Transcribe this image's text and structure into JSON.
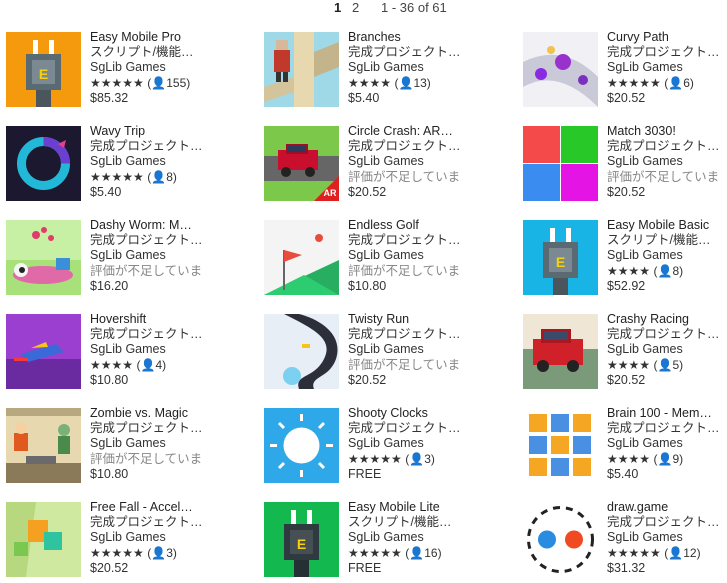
{
  "pagination": {
    "page1": "1",
    "page2": "2",
    "range": "1 - 36 of 61"
  },
  "items": [
    {
      "title": "Easy Mobile Pro",
      "category": "スクリプト/機能…",
      "publisher": "SgLib Games",
      "stars": "★★★★★",
      "count": "(👤155)",
      "price": "$85.32",
      "icon": "plug-orange-icon"
    },
    {
      "title": "Branches",
      "category": "完成プロジェクト…",
      "publisher": "SgLib Games",
      "stars": "★★★★",
      "count": "(👤13)",
      "price": "$5.40",
      "icon": "branches-icon"
    },
    {
      "title": "Curvy Path",
      "category": "完成プロジェクト…",
      "publisher": "SgLib Games",
      "stars": "★★★★★",
      "count": "(👤6)",
      "price": "$20.52",
      "icon": "curvy-path-icon"
    },
    {
      "title": "Wavy Trip",
      "category": "完成プロジェクト…",
      "publisher": "SgLib Games",
      "stars": "★★★★★",
      "count": "(👤8)",
      "price": "$5.40",
      "icon": "wavy-trip-icon"
    },
    {
      "title": "Circle Crash: AR…",
      "category": "完成プロジェクト…",
      "publisher": "SgLib Games",
      "no_rating": "評価が不足していま",
      "price": "$20.52",
      "icon": "circle-crash-icon"
    },
    {
      "title": "Match 3030!",
      "category": "完成プロジェクト…",
      "publisher": "SgLib Games",
      "no_rating": "評価が不足していま",
      "price": "$20.52",
      "icon": "match-3030-icon"
    },
    {
      "title": "Dashy Worm: M…",
      "category": "完成プロジェクト…",
      "publisher": "SgLib Games",
      "no_rating": "評価が不足していま",
      "price": "$16.20",
      "icon": "dashy-worm-icon"
    },
    {
      "title": "Endless Golf",
      "category": "完成プロジェクト…",
      "publisher": "SgLib Games",
      "no_rating": "評価が不足していま",
      "price": "$10.80",
      "icon": "endless-golf-icon"
    },
    {
      "title": "Easy Mobile Basic",
      "category": "スクリプト/機能…",
      "publisher": "SgLib Games",
      "stars": "★★★★",
      "count": "(👤8)",
      "price": "$52.92",
      "icon": "plug-cyan-icon"
    },
    {
      "title": "Hovershift",
      "category": "完成プロジェクト…",
      "publisher": "SgLib Games",
      "stars": "★★★★",
      "count": "(👤4)",
      "price": "$10.80",
      "icon": "hovershift-icon"
    },
    {
      "title": "Twisty Run",
      "category": "完成プロジェクト…",
      "publisher": "SgLib Games",
      "no_rating": "評価が不足していま",
      "price": "$20.52",
      "icon": "twisty-run-icon"
    },
    {
      "title": "Crashy Racing",
      "category": "完成プロジェクト…",
      "publisher": "SgLib Games",
      "stars": "★★★★",
      "count": "(👤5)",
      "price": "$20.52",
      "icon": "crashy-racing-icon"
    },
    {
      "title": "Zombie vs. Magic",
      "category": "完成プロジェクト…",
      "publisher": "SgLib Games",
      "no_rating": "評価が不足していま",
      "price": "$10.80",
      "icon": "zombie-magic-icon"
    },
    {
      "title": "Shooty Clocks",
      "category": "完成プロジェクト…",
      "publisher": "SgLib Games",
      "stars": "★★★★★",
      "count": "(👤3)",
      "price": "FREE",
      "icon": "shooty-clocks-icon"
    },
    {
      "title": "Brain 100 - Mem…",
      "category": "完成プロジェクト…",
      "publisher": "SgLib Games",
      "stars": "★★★★",
      "count": "(👤9)",
      "price": "$5.40",
      "icon": "brain-100-icon"
    },
    {
      "title": "Free Fall - Accel…",
      "category": "完成プロジェクト…",
      "publisher": "SgLib Games",
      "stars": "★★★★★",
      "count": "(👤3)",
      "price": "$20.52",
      "icon": "free-fall-icon"
    },
    {
      "title": "Easy Mobile Lite",
      "category": "スクリプト/機能…",
      "publisher": "SgLib Games",
      "stars": "★★★★★",
      "count": "(👤16)",
      "price": "FREE",
      "icon": "plug-green-icon"
    },
    {
      "title": "draw.game",
      "category": "完成プロジェクト…",
      "publisher": "SgLib Games",
      "stars": "★★★★★",
      "count": "(👤12)",
      "price": "$31.32",
      "icon": "draw-game-icon"
    }
  ]
}
